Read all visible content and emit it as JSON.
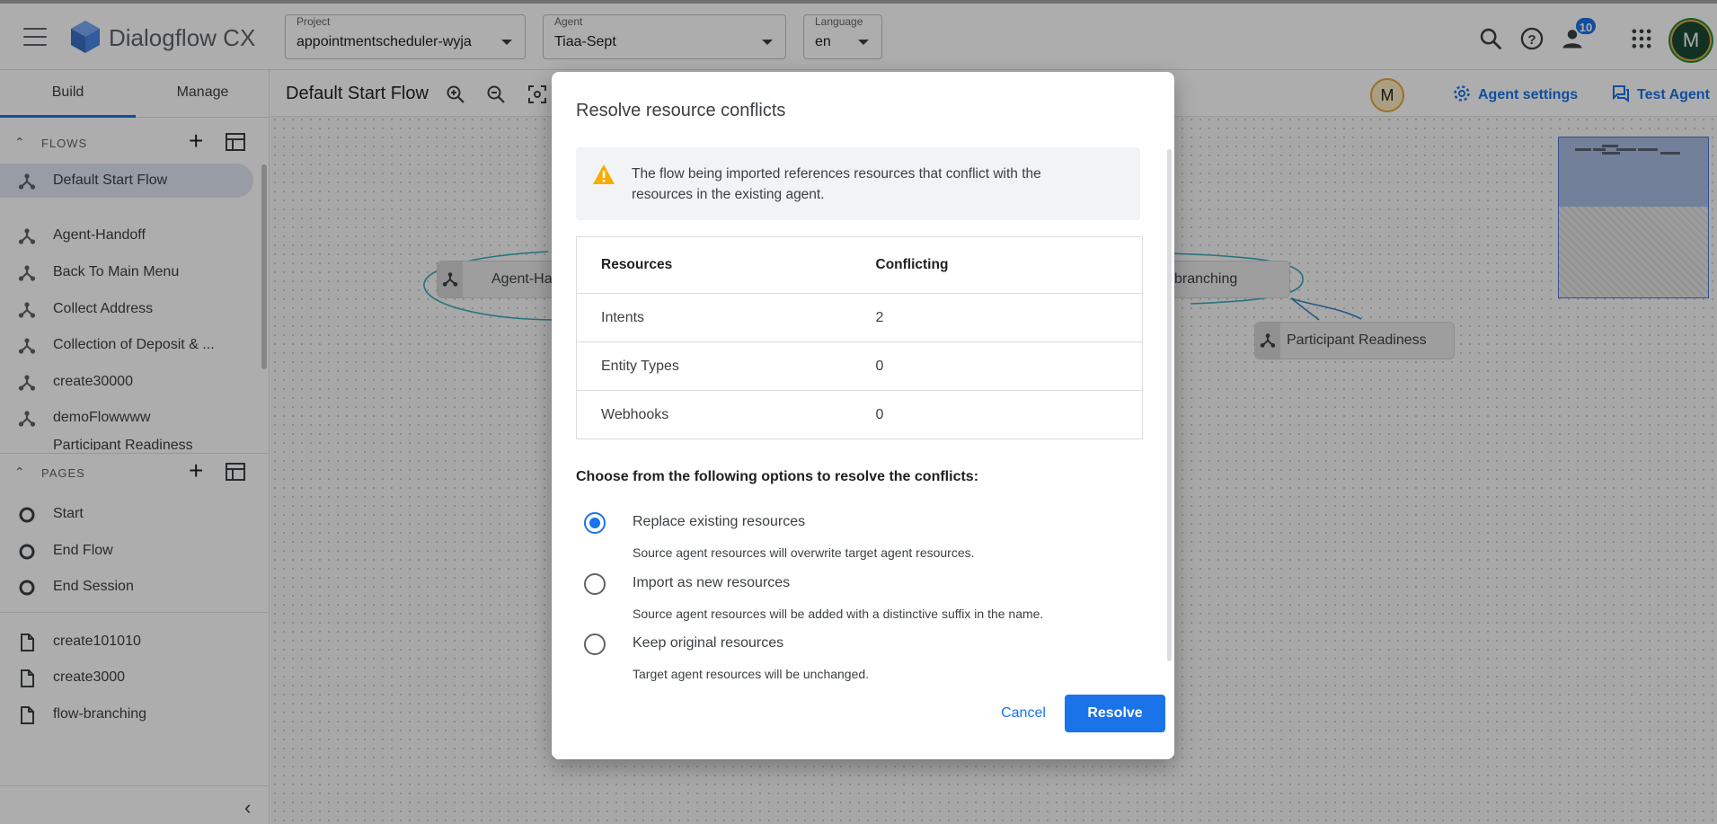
{
  "app": {
    "name": "Dialogflow CX"
  },
  "header": {
    "project": {
      "label": "Project",
      "value": "appointmentscheduler-wyja"
    },
    "agent": {
      "label": "Agent",
      "value": "Tiaa-Sept"
    },
    "language": {
      "label": "Language",
      "value": "en"
    },
    "notification_count": "10",
    "account_initial": "M"
  },
  "sidebar": {
    "tabs": [
      {
        "label": "Build"
      },
      {
        "label": "Manage"
      }
    ],
    "flows_title": "FLOWS",
    "flows": [
      {
        "label": "Default Start Flow"
      },
      {
        "label": "Agent-Handoff"
      },
      {
        "label": "Back To Main Menu"
      },
      {
        "label": "Collect Address"
      },
      {
        "label": "Collection of Deposit & ..."
      },
      {
        "label": "create30000"
      },
      {
        "label": "demoFlowwww"
      },
      {
        "label": "Participant Readiness"
      }
    ],
    "pages_title": "PAGES",
    "pages": [
      {
        "label": "Start"
      },
      {
        "label": "End Flow"
      },
      {
        "label": "End Session"
      }
    ],
    "page_files": [
      {
        "label": "create101010"
      },
      {
        "label": "create3000"
      },
      {
        "label": "flow-branching"
      }
    ]
  },
  "canvas": {
    "flow_title": "Default Start Flow",
    "collaborator_initial": "M",
    "agent_settings_label": "Agent settings",
    "test_agent_label": "Test Agent",
    "nodes": [
      {
        "label": "Agent-Ha"
      },
      {
        "label": "branching"
      },
      {
        "label": "Participant Readiness"
      }
    ]
  },
  "dialog": {
    "title": "Resolve resource conflicts",
    "warning": "The flow being imported references resources that conflict with the resources in the existing agent.",
    "table": {
      "headers": [
        "Resources",
        "Conflicting"
      ],
      "rows": [
        {
          "resource": "Intents",
          "count": "2"
        },
        {
          "resource": "Entity Types",
          "count": "0"
        },
        {
          "resource": "Webhooks",
          "count": "0"
        }
      ]
    },
    "prompt": "Choose from the following options to resolve the conflicts:",
    "options": [
      {
        "label": "Replace existing resources",
        "description": "Source agent resources will overwrite target agent resources.",
        "selected": true
      },
      {
        "label": "Import as new resources",
        "description": "Source agent resources will be added with a distinctive suffix in the name.",
        "selected": false
      },
      {
        "label": "Keep original resources",
        "description": "Target agent resources will be unchanged.",
        "selected": false
      }
    ],
    "cancel_label": "Cancel",
    "resolve_label": "Resolve"
  },
  "colors": {
    "accent": "#1a73e8",
    "warning": "#f9ab00"
  }
}
